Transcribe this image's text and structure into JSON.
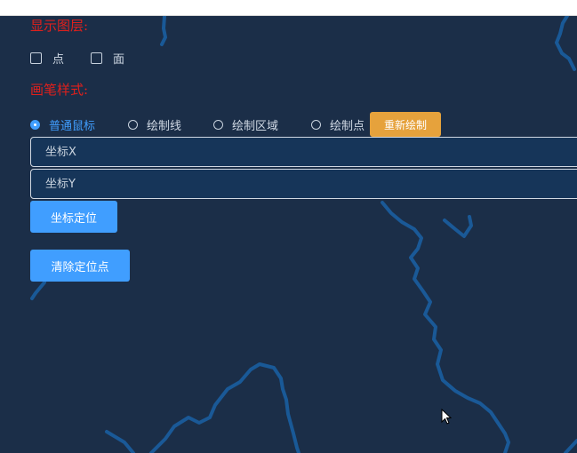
{
  "layers": {
    "title": "显示图层:",
    "options": [
      {
        "label": "点",
        "checked": false
      },
      {
        "label": "面",
        "checked": false
      }
    ]
  },
  "brush": {
    "title": "画笔样式:",
    "options": [
      {
        "label": "普通鼠标",
        "selected": true
      },
      {
        "label": "绘制线",
        "selected": false
      },
      {
        "label": "绘制区域",
        "selected": false
      },
      {
        "label": "绘制点",
        "selected": false
      }
    ],
    "redraw_label": "重新绘制"
  },
  "coords": {
    "x_placeholder": "坐标X",
    "y_placeholder": "坐标Y",
    "locate_label": "坐标定位",
    "clear_label": "清除定位点"
  },
  "colors": {
    "map_bg": "#1b2e48",
    "terrain_line": "#1a5ea0",
    "title_red": "#e0201c",
    "primary_blue": "#409eff",
    "warning_orange": "#e6a23c",
    "input_bg": "#163559"
  },
  "icons": {
    "cursor": "arrow-cursor-icon"
  }
}
